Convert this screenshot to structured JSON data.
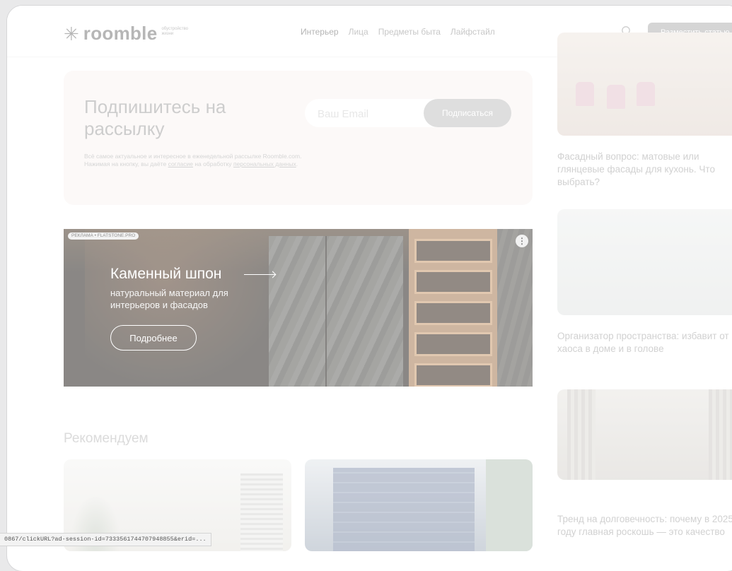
{
  "header": {
    "logo_text": "roomble",
    "logo_subtitle": "обустройство жизни",
    "nav": [
      "Интерьер",
      "Лица",
      "Предметы быта",
      "Лайфстайл"
    ],
    "post_button": "Разместить статью"
  },
  "subscribe": {
    "title": "Подпишитесь на рассылку",
    "desc_1": "Всё самое актуальное и интересное в еженедельной рассылке Roomble.com. Нажимая на кнопку, вы даёте ",
    "link_consent": "согласие",
    "desc_2": " на обработку ",
    "link_personal": "персональных данных",
    "desc_3": ".",
    "email_placeholder": "Ваш Email",
    "button": "Подписаться"
  },
  "ad": {
    "tag": "РЕКЛАМА • FLATSTONE.PRO",
    "title": "Каменный шпон",
    "subtitle": "натуральный материал для интерьеров и фасадов",
    "button": "Подробнее",
    "more_icon": "⋮"
  },
  "recommend": {
    "title": "Рекомендуем"
  },
  "side_articles": [
    {
      "title": "Фасадный вопрос: матовые или глянцевые фасады для кухонь. Что выбрать?"
    },
    {
      "title": "Организатор пространства: избавит от хаоса в доме и в голове"
    },
    {
      "title": "Тренд на долговечность: почему в 2025 году главная роскошь — это качество"
    }
  ],
  "status_bar": "0867/clickURL?ad-session-id=7333561744707948855&erid=..."
}
